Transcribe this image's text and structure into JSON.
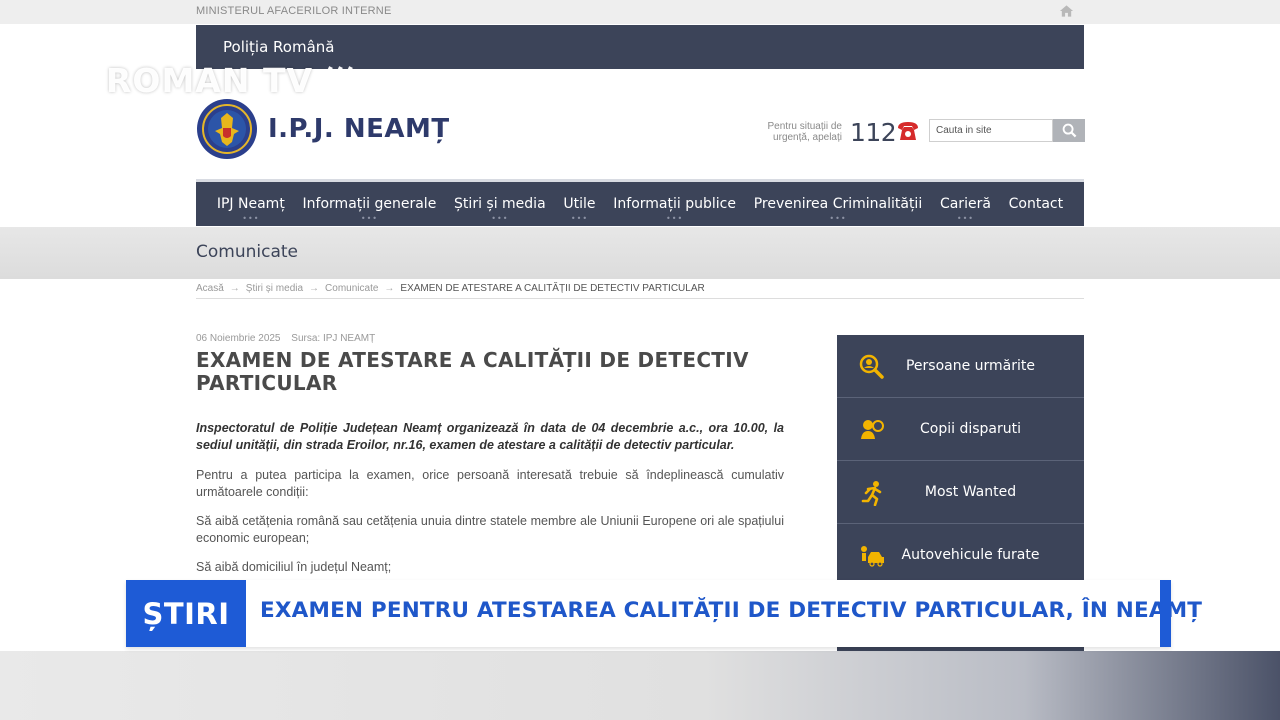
{
  "topbar": {
    "ministry": "MINISTERUL AFACERILOR INTERNE"
  },
  "brand_bar": {
    "label": "Poliția Română"
  },
  "watermark": {
    "text": "ROMAN TV"
  },
  "header": {
    "site_title": "I.P.J. NEAMȚ",
    "emergency_text": "Pentru situații de urgență, apelați",
    "emergency_number": "112",
    "search_placeholder": "Cauta in site"
  },
  "nav": {
    "items": [
      {
        "label": "IPJ Neamț"
      },
      {
        "label": "Informații generale"
      },
      {
        "label": "Știri și media"
      },
      {
        "label": "Utile"
      },
      {
        "label": "Informații publice"
      },
      {
        "label": "Prevenirea Criminalității"
      },
      {
        "label": "Carieră"
      },
      {
        "label": "Contact"
      }
    ]
  },
  "section": {
    "title": "Comunicate"
  },
  "breadcrumb": {
    "items": [
      "Acasă",
      "Știri și media",
      "Comunicate"
    ],
    "separator": "→",
    "current": "EXAMEN DE ATESTARE A CALITĂȚII DE DETECTIV PARTICULAR"
  },
  "article": {
    "date": "06 Noiembrie 2025",
    "source": "Sursa: IPJ NEAMȚ",
    "title": "EXAMEN DE ATESTARE A CALITĂȚII DE DETECTIV PARTICULAR",
    "lead": "Inspectoratul de Poliție Județean Neamț organizează în data de 04 decembrie a.c., ora 10.00, la sediul unității, din strada Eroilor, nr.16, examen de atestare a calității de detectiv particular.",
    "paragraphs": [
      "Pentru a putea participa la examen, orice persoană interesată trebuie să îndeplinească cumulativ următoarele condiții:",
      "Să aibă cetățenia română sau cetățenia unuia dintre statele membre ale Uniunii Europene ori ale spațiului economic european;",
      "Să aibă domiciliul în județul Neamț;"
    ]
  },
  "sidebar": {
    "items": [
      {
        "label": "Persoane urmărite",
        "icon": "search-person-icon"
      },
      {
        "label": "Copii disparuti",
        "icon": "child-icon"
      },
      {
        "label": "Most Wanted",
        "icon": "runner-icon"
      },
      {
        "label": "Autovehicule furate",
        "icon": "car-icon"
      }
    ]
  },
  "lower_third": {
    "tag": "ȘTIRI",
    "headline": "EXAMEN PENTRU ATESTAREA CALITĂȚII DE DETECTIV PARTICULAR, ÎN NEAMȚ"
  },
  "colors": {
    "nav_bg": "#3c4459",
    "title_blue": "#2e3a6b",
    "icon_gold": "#f2b400",
    "phone_red": "#d62b2b",
    "news_blue": "#1e5bd6"
  }
}
